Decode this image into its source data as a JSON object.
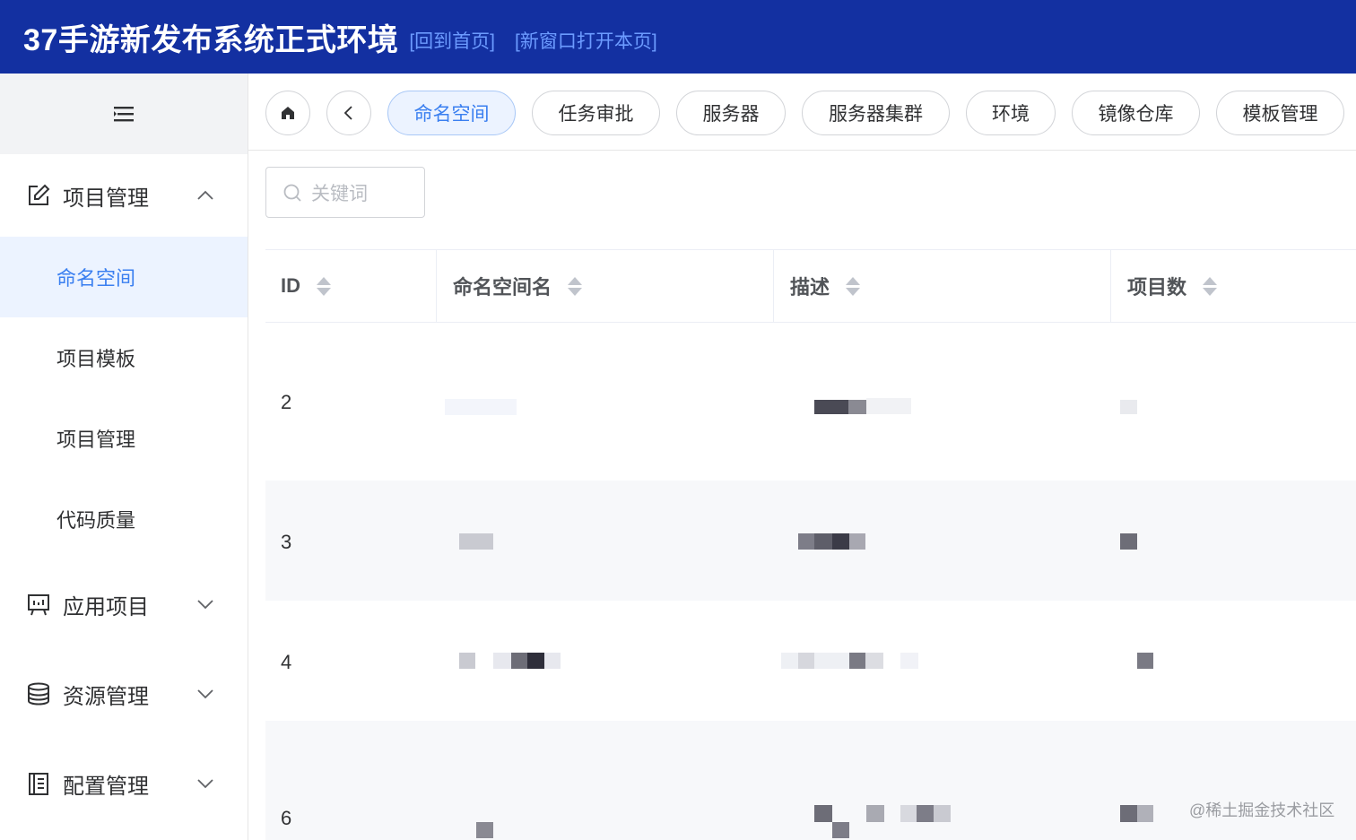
{
  "header": {
    "title": "37手游新发布系统正式环境",
    "back_home": "[回到首页]",
    "open_new_window": "[新窗口打开本页]"
  },
  "sidebar": {
    "groups": [
      {
        "label": "项目管理",
        "icon": "edit-icon",
        "expanded": true
      },
      {
        "label": "应用项目",
        "icon": "presentation-icon",
        "expanded": false
      },
      {
        "label": "资源管理",
        "icon": "database-icon",
        "expanded": false
      },
      {
        "label": "配置管理",
        "icon": "document-list-icon",
        "expanded": false
      }
    ],
    "sub_items": [
      "命名空间",
      "项目模板",
      "项目管理",
      "代码质量"
    ],
    "active_sub_item": "命名空间"
  },
  "tabs": {
    "items": [
      "命名空间",
      "任务审批",
      "服务器",
      "服务器集群",
      "环境",
      "镜像仓库",
      "模板管理"
    ],
    "active": "命名空间"
  },
  "search": {
    "placeholder": "关键词"
  },
  "table": {
    "columns": [
      "ID",
      "命名空间名",
      "描述",
      "项目数"
    ],
    "rows": [
      {
        "id": "2"
      },
      {
        "id": "3"
      },
      {
        "id": "4"
      },
      {
        "id": "6"
      }
    ]
  },
  "watermark": "@稀土掘金技术社区",
  "colors": {
    "header_bg": "#1330a1",
    "accent": "#3a7ff0",
    "active_bg": "#ecf3ff"
  }
}
